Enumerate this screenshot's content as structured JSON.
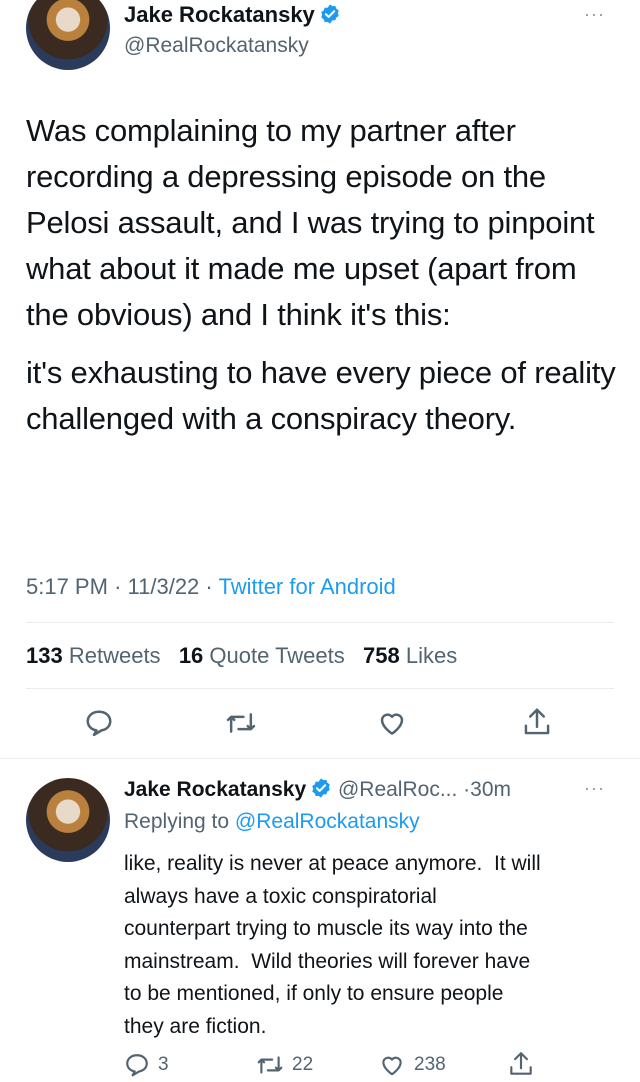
{
  "main_tweet": {
    "author_name": "Jake Rockatansky",
    "handle": "@RealRockatansky",
    "paragraphs": [
      "Was complaining to my partner after recording a depressing episode on the Pelosi assault, and I was trying to pinpoint what about it made me upset (apart from the obvious) and I think it's this:",
      "it's exhausting to have every piece of reality challenged with a conspiracy theory."
    ],
    "time": "5:17 PM",
    "date": "11/3/22",
    "source": "Twitter for Android",
    "separator": "·",
    "stats": {
      "retweets_count": "133",
      "retweets_label": "Retweets",
      "quotes_count": "16",
      "quotes_label": "Quote Tweets",
      "likes_count": "758",
      "likes_label": "Likes"
    },
    "more": "···"
  },
  "reply_tweet": {
    "author_name": "Jake Rockatansky",
    "handle": "@RealRoc...",
    "separator": "·",
    "time_ago": "30m",
    "replying_prefix": "Replying to",
    "replying_to": "@RealRockatansky",
    "lines": [
      "like, reality is never at peace anymore.  It will",
      "always have a toxic conspiratorial",
      "counterpart trying to muscle its way into the",
      "mainstream.  Wild theories will forever have",
      "to be mentioned, if only to ensure people",
      "they are fiction."
    ],
    "reply_count": "3",
    "retweet_count": "22",
    "like_count": "238",
    "more": "···"
  },
  "colors": {
    "accent": "#1d9bf0",
    "text": "#0f1419",
    "muted": "#536471",
    "divider": "#e6ecf0"
  },
  "icons": [
    "verified-badge-icon",
    "reply-icon",
    "retweet-icon",
    "like-icon",
    "share-icon",
    "more-icon"
  ]
}
